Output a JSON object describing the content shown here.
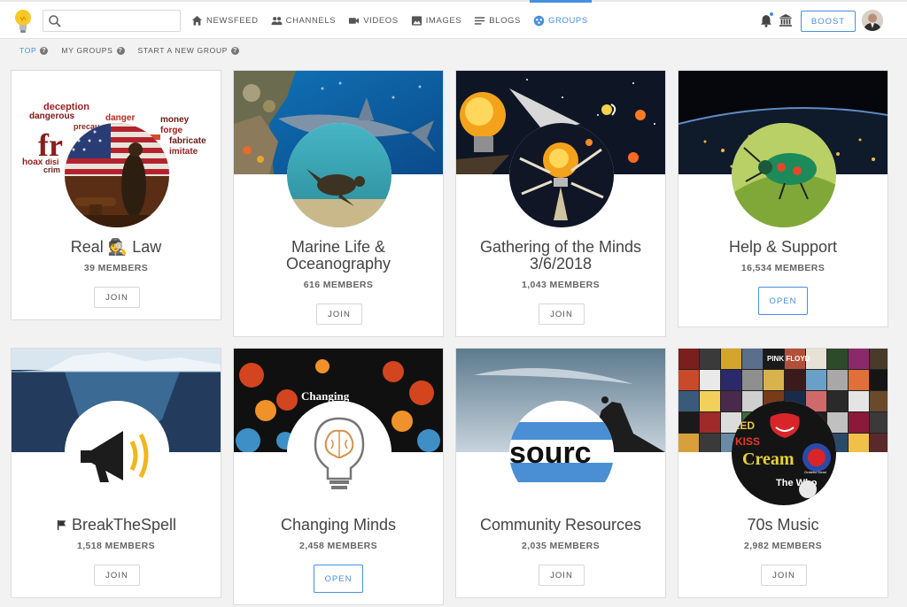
{
  "search": {
    "value": "",
    "placeholder": ""
  },
  "nav": [
    {
      "label": "NEWSFEED",
      "icon": "home-icon"
    },
    {
      "label": "CHANNELS",
      "icon": "people-icon"
    },
    {
      "label": "VIDEOS",
      "icon": "video-camera-icon"
    },
    {
      "label": "IMAGES",
      "icon": "image-icon"
    },
    {
      "label": "BLOGS",
      "icon": "list-icon"
    },
    {
      "label": "GROUPS",
      "icon": "groups-icon",
      "active": true
    }
  ],
  "header": {
    "boost_label": "BOOST"
  },
  "subnav": [
    {
      "label": "TOP",
      "active": true
    },
    {
      "label": "MY GROUPS"
    },
    {
      "label": "START A NEW GROUP"
    }
  ],
  "help_glyph": "?",
  "colors": {
    "accent": "#4690df",
    "text": "#444444",
    "background": "#f2f2f2"
  },
  "groups": [
    {
      "name": "Real 🕵 Law",
      "members": "39 MEMBERS",
      "action": "JOIN"
    },
    {
      "name": "Marine Life & Oceanography",
      "members": "616 MEMBERS",
      "action": "JOIN"
    },
    {
      "name": "Gathering of the Minds 3/6/2018",
      "members": "1,043 MEMBERS",
      "action": "JOIN"
    },
    {
      "name": "Help & Support",
      "members": "16,534 MEMBERS",
      "action": "OPEN"
    },
    {
      "name": "BreakTheSpell",
      "members": "1,518 MEMBERS",
      "action": "JOIN",
      "name_icon": "flag-icon"
    },
    {
      "name": "Changing Minds",
      "members": "2,458 MEMBERS",
      "action": "OPEN"
    },
    {
      "name": "Community Resources",
      "members": "2,035 MEMBERS",
      "action": "JOIN"
    },
    {
      "name": "70s Music",
      "members": "2,982 MEMBERS",
      "action": "JOIN"
    }
  ],
  "artwork_text": {
    "words": [
      "deception",
      "dangerous",
      "danger",
      "money",
      "precau",
      "forge",
      "fabricate",
      "imitate",
      "hoax",
      "crim",
      "fr",
      "disi"
    ],
    "changing": "Changing",
    "source": "sourc",
    "music": [
      "LED",
      "KISS",
      "Cream",
      "Grateful Dead",
      "PINK FLOYD",
      "The Who"
    ]
  }
}
